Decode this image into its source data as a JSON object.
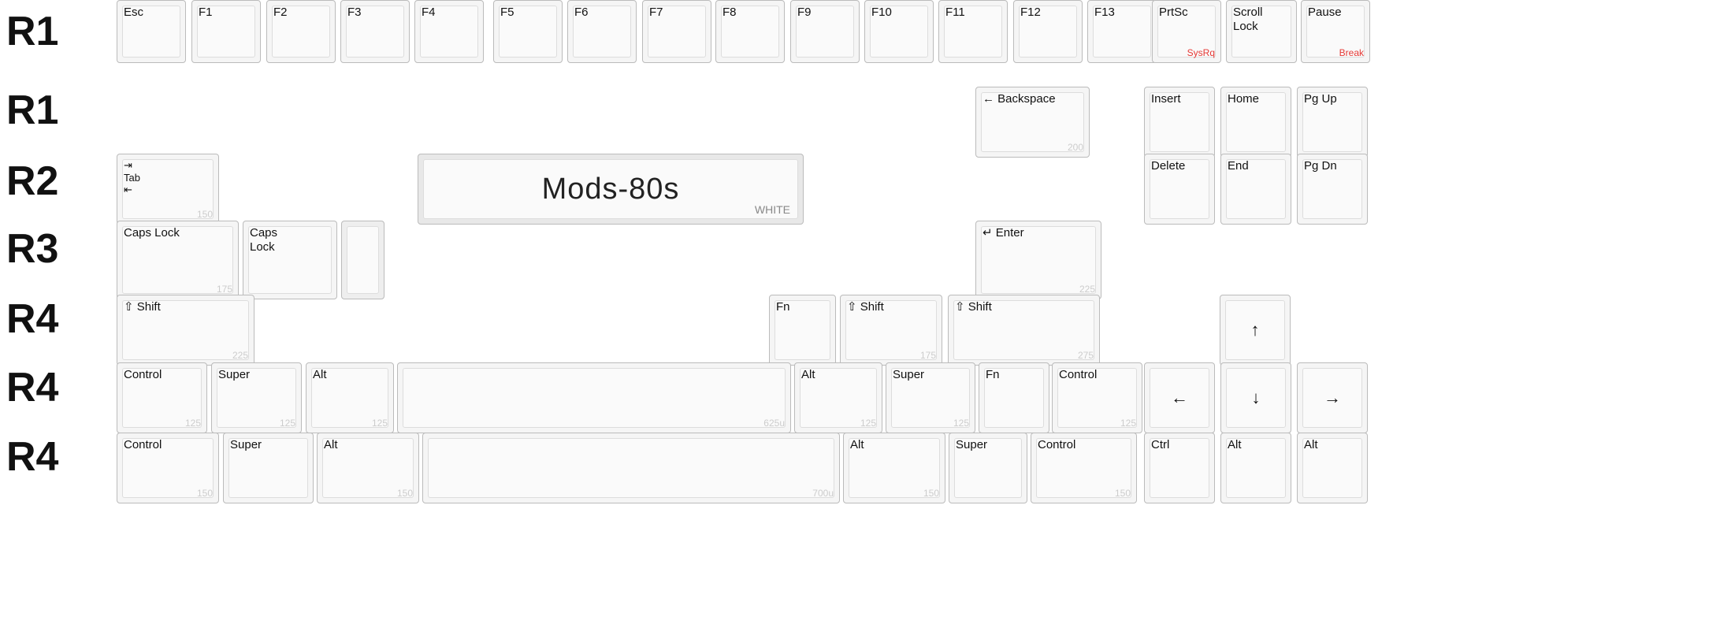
{
  "rows": {
    "r1_label_top": "R1",
    "r1_label_mid": "R1",
    "r2_label": "R2",
    "r3_label": "R3",
    "r4a_label": "R4",
    "r4b_label": "R4",
    "r4c_label": "R4"
  },
  "mods_title": "Mods-80s",
  "mods_subtitle": "WHITE",
  "function_row": {
    "keys": [
      {
        "label": "Esc",
        "sub": ""
      },
      {
        "label": "F1",
        "sub": ""
      },
      {
        "label": "F2",
        "sub": ""
      },
      {
        "label": "F3",
        "sub": ""
      },
      {
        "label": "F4",
        "sub": ""
      },
      {
        "label": "F5",
        "sub": ""
      },
      {
        "label": "F6",
        "sub": ""
      },
      {
        "label": "F7",
        "sub": ""
      },
      {
        "label": "F8",
        "sub": ""
      },
      {
        "label": "F9",
        "sub": ""
      },
      {
        "label": "F10",
        "sub": ""
      },
      {
        "label": "F11",
        "sub": ""
      },
      {
        "label": "F12",
        "sub": ""
      },
      {
        "label": "F13",
        "sub": ""
      },
      {
        "label": "PrtSc",
        "sub": "SysRq",
        "red": true
      },
      {
        "label": "Scroll\nLock",
        "sub": ""
      },
      {
        "label": "Pause",
        "sub": "Break",
        "red": true
      }
    ]
  },
  "r1_mid": {
    "backspace": {
      "label": "← Backspace",
      "sub": "200"
    },
    "insert": {
      "label": "Insert",
      "sub": ""
    },
    "home": {
      "label": "Home",
      "sub": ""
    },
    "pgup": {
      "label": "Pg Up",
      "sub": ""
    }
  },
  "r2": {
    "tab": {
      "label": "↦\nTab\n↤",
      "sub": "150"
    },
    "delete": {
      "label": "Delete",
      "sub": ""
    },
    "end": {
      "label": "End",
      "sub": ""
    },
    "pgdn": {
      "label": "Pg Dn",
      "sub": ""
    }
  },
  "r3": {
    "capslock1": {
      "label": "Caps Lock",
      "sub": "175"
    },
    "capslock2": {
      "label": "Caps\nLock",
      "sub": ""
    },
    "enter": {
      "label": "↵ Enter",
      "sub": "225"
    }
  },
  "r4a": {
    "shift_l": {
      "label": "⇧ Shift",
      "sub": "225"
    },
    "fn": {
      "label": "Fn",
      "sub": ""
    },
    "shift_r1": {
      "label": "⇧ Shift",
      "sub": "175"
    },
    "shift_r2": {
      "label": "⇧ Shift",
      "sub": "275"
    },
    "arrow_up": {
      "label": "↑",
      "sub": ""
    }
  },
  "r4b": {
    "ctrl_l": {
      "label": "Control",
      "sub": "125"
    },
    "super_l": {
      "label": "Super",
      "sub": "125"
    },
    "alt_l": {
      "label": "Alt",
      "sub": "125"
    },
    "space": {
      "label": "",
      "sub": "625u"
    },
    "alt_r": {
      "label": "Alt",
      "sub": "125"
    },
    "super_r": {
      "label": "Super",
      "sub": "125"
    },
    "fn": {
      "label": "Fn",
      "sub": ""
    },
    "ctrl_r": {
      "label": "Control",
      "sub": "125"
    },
    "arrow_left": {
      "label": "←",
      "sub": ""
    },
    "arrow_down": {
      "label": "↓",
      "sub": ""
    },
    "arrow_right": {
      "label": "→",
      "sub": ""
    }
  },
  "r4c": {
    "ctrl_l": {
      "label": "Control",
      "sub": "150"
    },
    "super_l": {
      "label": "Super",
      "sub": ""
    },
    "alt_l": {
      "label": "Alt",
      "sub": "150"
    },
    "space": {
      "label": "",
      "sub": "700u"
    },
    "alt_r": {
      "label": "Alt",
      "sub": "150"
    },
    "super_r": {
      "label": "Super",
      "sub": ""
    },
    "ctrl_r": {
      "label": "Control",
      "sub": "150"
    },
    "ctrl_nav": {
      "label": "Ctrl",
      "sub": ""
    },
    "alt_nav": {
      "label": "Alt",
      "sub": ""
    },
    "alt_nav2": {
      "label": "Alt",
      "sub": ""
    }
  }
}
